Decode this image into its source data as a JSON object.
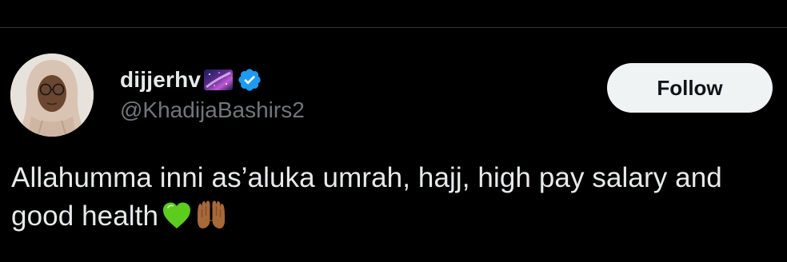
{
  "tweet": {
    "author": {
      "display_name": "dijjerhv",
      "handle": "@KhadijaBashirs2",
      "name_icon": "galaxy-sky-icon",
      "verified": true,
      "verified_icon": "verified-badge-icon"
    },
    "follow_label": "Follow",
    "text": "Allahumma inni as’aluka umrah, hajj, high pay salary and good health",
    "emojis": [
      "green-heart-icon",
      "palms-up-together-icon"
    ]
  },
  "colors": {
    "background": "#000000",
    "primary_text": "#e7e9ea",
    "secondary_text": "#71767b",
    "verified_blue": "#1d9bf0",
    "follow_button_bg": "#eff3f4",
    "follow_button_text": "#0f1419",
    "divider": "#2f3336"
  }
}
